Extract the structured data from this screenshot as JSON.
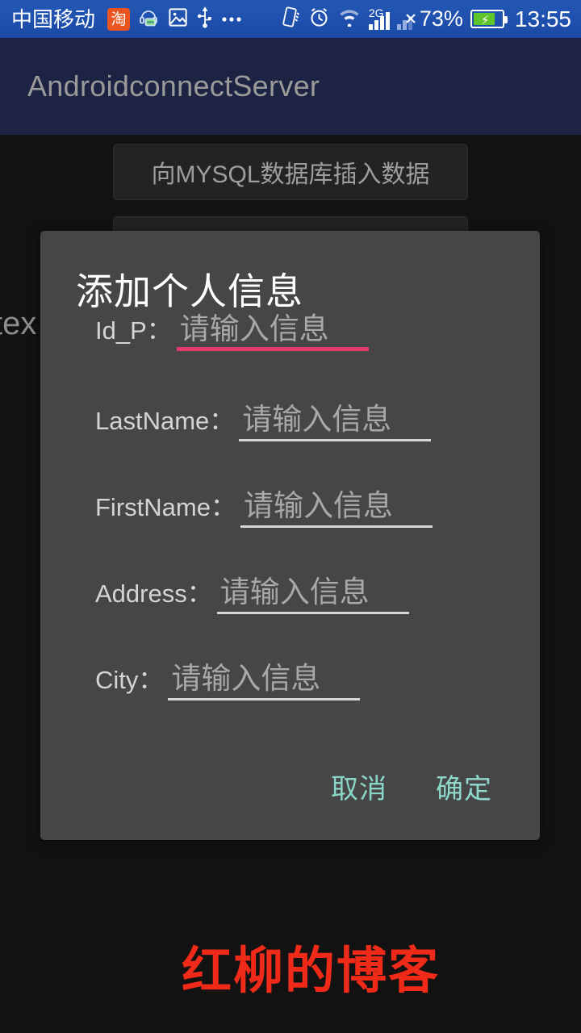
{
  "status_bar": {
    "carrier": "中国移动",
    "taobao_glyph": "淘",
    "network": "2G",
    "battery_percent": "73%",
    "time": "13:55",
    "icons": [
      "taobao-icon",
      "chat-headset-icon",
      "image-icon",
      "usb-icon",
      "more-dots-icon",
      "vibrate-icon",
      "alarm-clock-icon",
      "wifi-icon",
      "signal-2g-icon",
      "sim2-no-service-icon",
      "battery-charging-icon"
    ]
  },
  "action_bar": {
    "title": "AndroidconnectServer"
  },
  "app": {
    "button_insert": "向MYSQL数据库插入数据",
    "button_second": "",
    "background_text": "tex"
  },
  "dialog": {
    "title": "添加个人信息",
    "placeholder": "请输入信息",
    "fields": [
      {
        "label": "Id_P：",
        "value": "",
        "placeholder": "请输入信息",
        "focused": true
      },
      {
        "label": "LastName：",
        "value": "",
        "placeholder": "请输入信息",
        "focused": false
      },
      {
        "label": "FirstName：",
        "value": "",
        "placeholder": "请输入信息",
        "focused": false
      },
      {
        "label": "Address：",
        "value": "",
        "placeholder": "请输入信息",
        "focused": false
      },
      {
        "label": "City：",
        "value": "",
        "placeholder": "请输入信息",
        "focused": false
      }
    ],
    "cancel_label": "取消",
    "confirm_label": "确定",
    "accent_focused": "#e63a6d",
    "accent_button": "#8ad7c8"
  },
  "watermark": {
    "text": "红柳的博客",
    "color": "#ef2a18"
  }
}
